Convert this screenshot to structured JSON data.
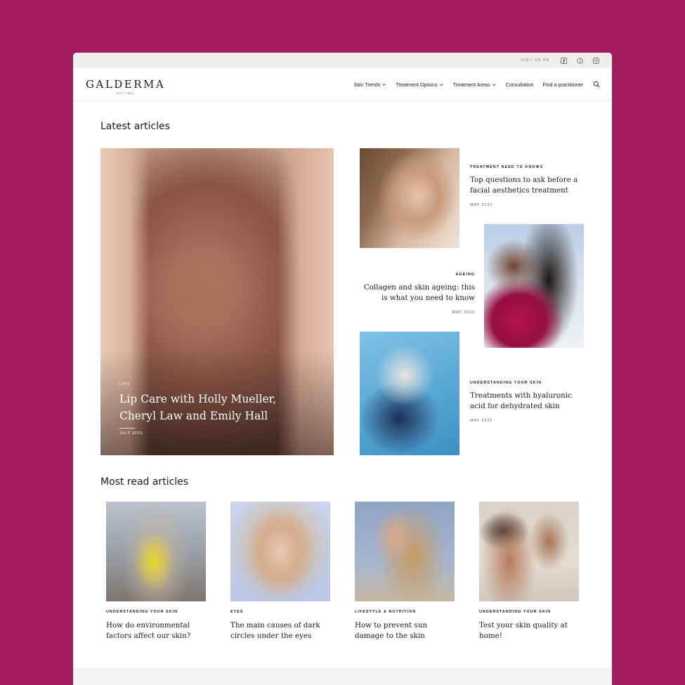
{
  "topbar": {
    "visit_label": "VISIT US ON",
    "social_icons": [
      "facebook-icon",
      "pinterest-icon",
      "instagram-icon"
    ]
  },
  "brand": {
    "name": "GALDERMA",
    "est": "EST 1981"
  },
  "nav": {
    "items": [
      {
        "label": "Skin Trends",
        "dropdown": true
      },
      {
        "label": "Treatment Options",
        "dropdown": true
      },
      {
        "label": "Treatment Areas",
        "dropdown": true
      },
      {
        "label": "Consultation",
        "dropdown": false
      },
      {
        "label": "Find a practitioner",
        "dropdown": false
      }
    ],
    "search_icon": "search-icon"
  },
  "latest": {
    "heading": "Latest articles",
    "hero": {
      "category": "LIPS",
      "title": "Lip Care with Holly Mueller, Cheryl Law and Emily Hall",
      "date": "JULY 2023"
    },
    "articles": [
      {
        "category": "TREATMENT NEED TO KNOWS",
        "title": "Top questions to ask before a facial aesthetics treatment",
        "date": "MAY 2022"
      },
      {
        "category": "AGEING",
        "title": "Collagen and skin ageing: this is what you need to know",
        "date": "MAY 2022"
      },
      {
        "category": "UNDERSTANDING YOUR SKIN",
        "title": "Treatments with hyaluronic acid for dehydrated skin",
        "date": "MAY 2022"
      }
    ]
  },
  "most_read": {
    "heading": "Most read articles",
    "articles": [
      {
        "category": "UNDERSTANDING YOUR SKIN",
        "title": "How do environmental factors affect our skin?"
      },
      {
        "category": "EYES",
        "title": "The main causes of dark circles under the eyes"
      },
      {
        "category": "LIFESTYLE & NUTRITION",
        "title": "How to prevent sun damage to the skin"
      },
      {
        "category": "UNDERSTANDING YOUR SKIN",
        "title": "Test your skin quality at home!"
      }
    ]
  },
  "colors": {
    "background": "#a21c5e",
    "text": "#1a1a1a"
  }
}
